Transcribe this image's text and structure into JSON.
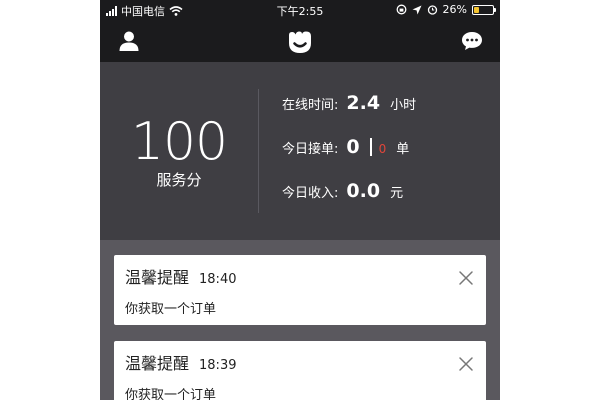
{
  "status_bar": {
    "carrier": "中国电信",
    "time": "下午2:55",
    "battery": "26%",
    "battery_level": 0.26
  },
  "nav": {
    "icons": [
      "user-icon",
      "app-logo-icon",
      "chat-bubble-icon"
    ]
  },
  "stats": {
    "score_value": "100",
    "score_label": "服务分",
    "online_label": "在线时间:",
    "online_value": "2.4",
    "online_unit": "小时",
    "orders_label": "今日接单:",
    "orders_value": "0",
    "orders_secondary": "0",
    "orders_unit": "单",
    "income_label": "今日收入:",
    "income_value": "0.0",
    "income_unit": "元"
  },
  "notifications": [
    {
      "title": "温馨提醒",
      "time": "18:40",
      "message": "你获取一个订单"
    },
    {
      "title": "温馨提醒",
      "time": "18:39",
      "message": "你获取一个订单"
    }
  ],
  "colors": {
    "status_bar_bg": "#1b1b1d",
    "stats_bg": "#3f3e43",
    "page_bg": "#5a585e",
    "accent_red": "#e0453a",
    "battery_fill": "#f4c430"
  }
}
